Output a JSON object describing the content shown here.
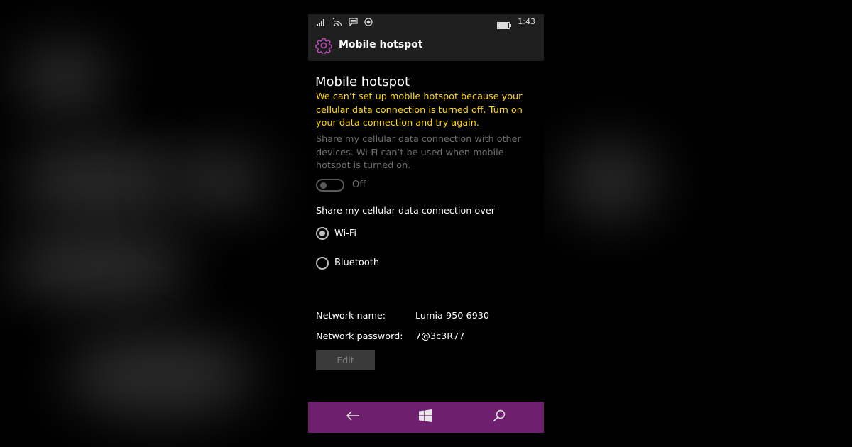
{
  "status_bar": {
    "time": "1:43",
    "icons": [
      "signal-bars-icon",
      "wifi-icon",
      "notification-icon",
      "location-icon",
      "battery-icon"
    ]
  },
  "header": {
    "title": "Mobile hotspot",
    "icon": "gear-icon"
  },
  "content": {
    "title": "Mobile hotspot",
    "warning": "We can’t set up mobile hotspot because your cellular data connection is turned off. Turn on your data connection and try again.",
    "description": "Share my cellular data connection with other devices. Wi-Fi can’t be used when mobile hotspot is turned on.",
    "toggle": {
      "label": "Off",
      "state": "off"
    },
    "share_over": {
      "label": "Share my cellular data connection over",
      "options": [
        {
          "label": "Wi-Fi",
          "selected": true
        },
        {
          "label": "Bluetooth",
          "selected": false
        }
      ]
    },
    "network": {
      "name_label": "Network name:",
      "name_value": "Lumia 950 6930",
      "password_label": "Network password:",
      "password_value": "7@3c3R77"
    },
    "edit_button": "Edit"
  },
  "nav_bar": {
    "items": [
      "back-arrow-icon",
      "windows-logo-icon",
      "search-icon"
    ]
  },
  "colors": {
    "accent": "#6e1f6e",
    "header_icon": "#c44fc4",
    "warning": "#ffd700",
    "disabled_text": "#6e6e6e",
    "chrome": "#1f1f1f"
  }
}
